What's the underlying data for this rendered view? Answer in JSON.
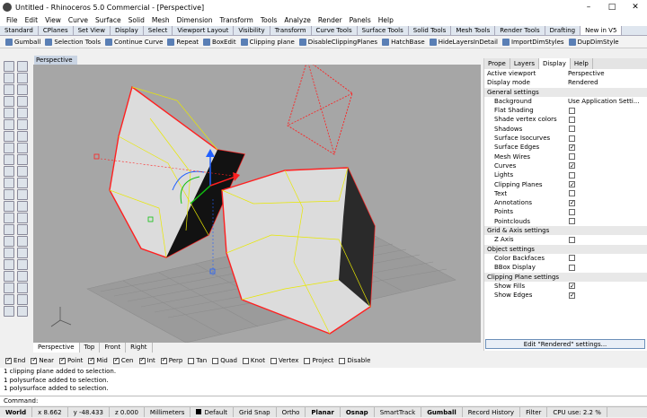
{
  "window": {
    "title": "Untitled - Rhinoceros 5.0 Commercial - [Perspective]"
  },
  "menu": [
    "File",
    "Edit",
    "View",
    "Curve",
    "Surface",
    "Solid",
    "Mesh",
    "Dimension",
    "Transform",
    "Tools",
    "Analyze",
    "Render",
    "Panels",
    "Help"
  ],
  "tabs": [
    "Standard",
    "CPlanes",
    "Set View",
    "Display",
    "Select",
    "Viewport Layout",
    "Visibility",
    "Transform",
    "Curve Tools",
    "Surface Tools",
    "Solid Tools",
    "Mesh Tools",
    "Render Tools",
    "Drafting",
    "New in V5"
  ],
  "toolbar": [
    "Gumball",
    "Selection Tools",
    "Continue Curve",
    "Repeat",
    "BoxEdit",
    "Clipping plane",
    "DisableClippingPlanes",
    "HatchBase",
    "HideLayersInDetail",
    "ImportDimStyles",
    "DupDimStyle"
  ],
  "viewport": {
    "label": "Perspective",
    "tabs": [
      "Perspective",
      "Top",
      "Front",
      "Right"
    ]
  },
  "panel": {
    "tabs": [
      "Prope",
      "Layers",
      "Display",
      "Help"
    ],
    "active_viewport_label": "Active viewport",
    "active_viewport_value": "Perspective",
    "display_mode_label": "Display mode",
    "display_mode_value": "Rendered",
    "general": "General settings",
    "background_label": "Background",
    "background_value": "Use Application Setti...",
    "checks": [
      {
        "label": "Flat Shading",
        "on": false
      },
      {
        "label": "Shade vertex colors",
        "on": false
      },
      {
        "label": "Shadows",
        "on": false
      },
      {
        "label": "Surface Isocurves",
        "on": false
      },
      {
        "label": "Surface Edges",
        "on": true
      },
      {
        "label": "Mesh Wires",
        "on": false
      },
      {
        "label": "Curves",
        "on": true
      },
      {
        "label": "Lights",
        "on": false
      },
      {
        "label": "Clipping Planes",
        "on": true
      },
      {
        "label": "Text",
        "on": false
      },
      {
        "label": "Annotations",
        "on": true
      },
      {
        "label": "Points",
        "on": false
      },
      {
        "label": "Pointclouds",
        "on": false
      }
    ],
    "grid_header": "Grid & Axis settings",
    "zaxis": {
      "label": "Z Axis",
      "on": false
    },
    "object_header": "Object settings",
    "object_checks": [
      {
        "label": "Color Backfaces",
        "on": false
      },
      {
        "label": "BBox Display",
        "on": false
      }
    ],
    "clip_header": "Clipping Plane settings",
    "clip_checks": [
      {
        "label": "Show Fills",
        "on": true
      },
      {
        "label": "Show Edges",
        "on": true
      }
    ],
    "edit_button": "Edit \"Rendered\" settings..."
  },
  "osnap": [
    {
      "label": "End",
      "on": true
    },
    {
      "label": "Near",
      "on": true
    },
    {
      "label": "Point",
      "on": true
    },
    {
      "label": "Mid",
      "on": true
    },
    {
      "label": "Cen",
      "on": true
    },
    {
      "label": "Int",
      "on": true
    },
    {
      "label": "Perp",
      "on": true
    },
    {
      "label": "Tan",
      "on": false
    },
    {
      "label": "Quad",
      "on": false
    },
    {
      "label": "Knot",
      "on": false
    },
    {
      "label": "Vertex",
      "on": false
    },
    {
      "label": "Project",
      "on": false
    },
    {
      "label": "Disable",
      "on": false
    }
  ],
  "history": [
    "1 clipping plane added to selection.",
    "1 polysurface added to selection.",
    "1 polysurface added to selection."
  ],
  "command_label": "Command:",
  "status": {
    "cplane": "World",
    "x": "x 8.662",
    "y": "y -48.433",
    "z": "z 0.000",
    "units": "Millimeters",
    "layer": "Default",
    "items": [
      "Grid Snap",
      "Ortho",
      "Planar",
      "Osnap",
      "SmartTrack",
      "Gumball",
      "Record History",
      "Filter",
      "CPU use: 2.2 %"
    ]
  },
  "colors": {
    "selection": "#ff2020",
    "curves": "#e8e800",
    "viewport_bg": "#a6a6a6"
  }
}
